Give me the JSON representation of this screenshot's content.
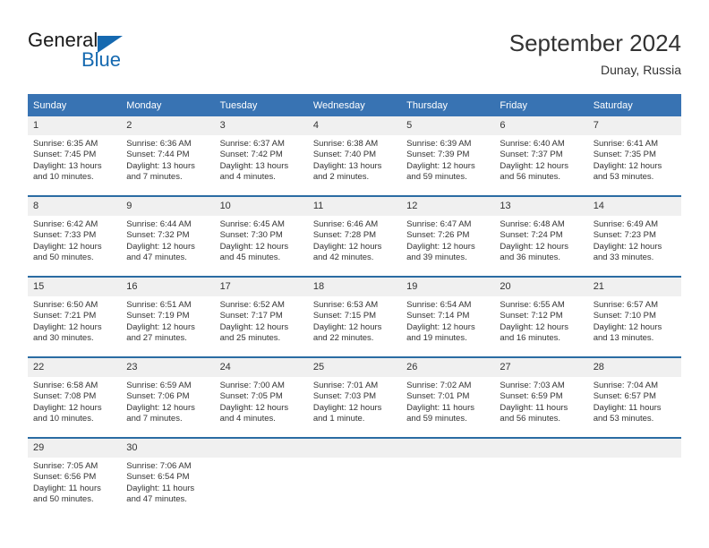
{
  "brand": {
    "name_part1": "General",
    "name_part2": "Blue",
    "triangle_icon": "triangle-icon",
    "color_black": "#1a1a1a",
    "color_blue": "#1569b0"
  },
  "header": {
    "title": "September 2024",
    "subtitle": "Dunay, Russia"
  },
  "colors": {
    "header_blue": "#3873b3",
    "row_rule_blue": "#2b6ca3",
    "daynum_band": "#f0f0f0",
    "text": "#333333"
  },
  "weekdays": [
    "Sunday",
    "Monday",
    "Tuesday",
    "Wednesday",
    "Thursday",
    "Friday",
    "Saturday"
  ],
  "weeks": [
    [
      {
        "day": "1",
        "sunrise": "Sunrise: 6:35 AM",
        "sunset": "Sunset: 7:45 PM",
        "daylight1": "Daylight: 13 hours",
        "daylight2": "and 10 minutes."
      },
      {
        "day": "2",
        "sunrise": "Sunrise: 6:36 AM",
        "sunset": "Sunset: 7:44 PM",
        "daylight1": "Daylight: 13 hours",
        "daylight2": "and 7 minutes."
      },
      {
        "day": "3",
        "sunrise": "Sunrise: 6:37 AM",
        "sunset": "Sunset: 7:42 PM",
        "daylight1": "Daylight: 13 hours",
        "daylight2": "and 4 minutes."
      },
      {
        "day": "4",
        "sunrise": "Sunrise: 6:38 AM",
        "sunset": "Sunset: 7:40 PM",
        "daylight1": "Daylight: 13 hours",
        "daylight2": "and 2 minutes."
      },
      {
        "day": "5",
        "sunrise": "Sunrise: 6:39 AM",
        "sunset": "Sunset: 7:39 PM",
        "daylight1": "Daylight: 12 hours",
        "daylight2": "and 59 minutes."
      },
      {
        "day": "6",
        "sunrise": "Sunrise: 6:40 AM",
        "sunset": "Sunset: 7:37 PM",
        "daylight1": "Daylight: 12 hours",
        "daylight2": "and 56 minutes."
      },
      {
        "day": "7",
        "sunrise": "Sunrise: 6:41 AM",
        "sunset": "Sunset: 7:35 PM",
        "daylight1": "Daylight: 12 hours",
        "daylight2": "and 53 minutes."
      }
    ],
    [
      {
        "day": "8",
        "sunrise": "Sunrise: 6:42 AM",
        "sunset": "Sunset: 7:33 PM",
        "daylight1": "Daylight: 12 hours",
        "daylight2": "and 50 minutes."
      },
      {
        "day": "9",
        "sunrise": "Sunrise: 6:44 AM",
        "sunset": "Sunset: 7:32 PM",
        "daylight1": "Daylight: 12 hours",
        "daylight2": "and 47 minutes."
      },
      {
        "day": "10",
        "sunrise": "Sunrise: 6:45 AM",
        "sunset": "Sunset: 7:30 PM",
        "daylight1": "Daylight: 12 hours",
        "daylight2": "and 45 minutes."
      },
      {
        "day": "11",
        "sunrise": "Sunrise: 6:46 AM",
        "sunset": "Sunset: 7:28 PM",
        "daylight1": "Daylight: 12 hours",
        "daylight2": "and 42 minutes."
      },
      {
        "day": "12",
        "sunrise": "Sunrise: 6:47 AM",
        "sunset": "Sunset: 7:26 PM",
        "daylight1": "Daylight: 12 hours",
        "daylight2": "and 39 minutes."
      },
      {
        "day": "13",
        "sunrise": "Sunrise: 6:48 AM",
        "sunset": "Sunset: 7:24 PM",
        "daylight1": "Daylight: 12 hours",
        "daylight2": "and 36 minutes."
      },
      {
        "day": "14",
        "sunrise": "Sunrise: 6:49 AM",
        "sunset": "Sunset: 7:23 PM",
        "daylight1": "Daylight: 12 hours",
        "daylight2": "and 33 minutes."
      }
    ],
    [
      {
        "day": "15",
        "sunrise": "Sunrise: 6:50 AM",
        "sunset": "Sunset: 7:21 PM",
        "daylight1": "Daylight: 12 hours",
        "daylight2": "and 30 minutes."
      },
      {
        "day": "16",
        "sunrise": "Sunrise: 6:51 AM",
        "sunset": "Sunset: 7:19 PM",
        "daylight1": "Daylight: 12 hours",
        "daylight2": "and 27 minutes."
      },
      {
        "day": "17",
        "sunrise": "Sunrise: 6:52 AM",
        "sunset": "Sunset: 7:17 PM",
        "daylight1": "Daylight: 12 hours",
        "daylight2": "and 25 minutes."
      },
      {
        "day": "18",
        "sunrise": "Sunrise: 6:53 AM",
        "sunset": "Sunset: 7:15 PM",
        "daylight1": "Daylight: 12 hours",
        "daylight2": "and 22 minutes."
      },
      {
        "day": "19",
        "sunrise": "Sunrise: 6:54 AM",
        "sunset": "Sunset: 7:14 PM",
        "daylight1": "Daylight: 12 hours",
        "daylight2": "and 19 minutes."
      },
      {
        "day": "20",
        "sunrise": "Sunrise: 6:55 AM",
        "sunset": "Sunset: 7:12 PM",
        "daylight1": "Daylight: 12 hours",
        "daylight2": "and 16 minutes."
      },
      {
        "day": "21",
        "sunrise": "Sunrise: 6:57 AM",
        "sunset": "Sunset: 7:10 PM",
        "daylight1": "Daylight: 12 hours",
        "daylight2": "and 13 minutes."
      }
    ],
    [
      {
        "day": "22",
        "sunrise": "Sunrise: 6:58 AM",
        "sunset": "Sunset: 7:08 PM",
        "daylight1": "Daylight: 12 hours",
        "daylight2": "and 10 minutes."
      },
      {
        "day": "23",
        "sunrise": "Sunrise: 6:59 AM",
        "sunset": "Sunset: 7:06 PM",
        "daylight1": "Daylight: 12 hours",
        "daylight2": "and 7 minutes."
      },
      {
        "day": "24",
        "sunrise": "Sunrise: 7:00 AM",
        "sunset": "Sunset: 7:05 PM",
        "daylight1": "Daylight: 12 hours",
        "daylight2": "and 4 minutes."
      },
      {
        "day": "25",
        "sunrise": "Sunrise: 7:01 AM",
        "sunset": "Sunset: 7:03 PM",
        "daylight1": "Daylight: 12 hours",
        "daylight2": "and 1 minute."
      },
      {
        "day": "26",
        "sunrise": "Sunrise: 7:02 AM",
        "sunset": "Sunset: 7:01 PM",
        "daylight1": "Daylight: 11 hours",
        "daylight2": "and 59 minutes."
      },
      {
        "day": "27",
        "sunrise": "Sunrise: 7:03 AM",
        "sunset": "Sunset: 6:59 PM",
        "daylight1": "Daylight: 11 hours",
        "daylight2": "and 56 minutes."
      },
      {
        "day": "28",
        "sunrise": "Sunrise: 7:04 AM",
        "sunset": "Sunset: 6:57 PM",
        "daylight1": "Daylight: 11 hours",
        "daylight2": "and 53 minutes."
      }
    ],
    [
      {
        "day": "29",
        "sunrise": "Sunrise: 7:05 AM",
        "sunset": "Sunset: 6:56 PM",
        "daylight1": "Daylight: 11 hours",
        "daylight2": "and 50 minutes."
      },
      {
        "day": "30",
        "sunrise": "Sunrise: 7:06 AM",
        "sunset": "Sunset: 6:54 PM",
        "daylight1": "Daylight: 11 hours",
        "daylight2": "and 47 minutes."
      },
      {
        "day": "",
        "sunrise": "",
        "sunset": "",
        "daylight1": "",
        "daylight2": ""
      },
      {
        "day": "",
        "sunrise": "",
        "sunset": "",
        "daylight1": "",
        "daylight2": ""
      },
      {
        "day": "",
        "sunrise": "",
        "sunset": "",
        "daylight1": "",
        "daylight2": ""
      },
      {
        "day": "",
        "sunrise": "",
        "sunset": "",
        "daylight1": "",
        "daylight2": ""
      },
      {
        "day": "",
        "sunrise": "",
        "sunset": "",
        "daylight1": "",
        "daylight2": ""
      }
    ]
  ]
}
